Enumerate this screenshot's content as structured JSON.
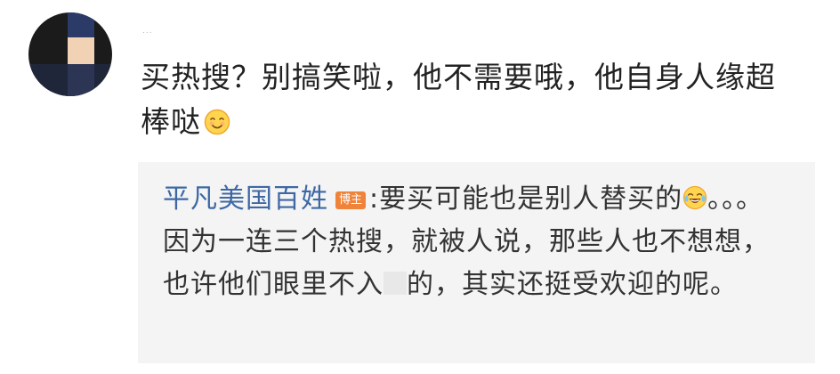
{
  "comment": {
    "username": "...",
    "text": "买热搜？别搞笑啦，他不需要哦，他自身人缘超棒哒",
    "emoji": "smile-emoji"
  },
  "reply": {
    "author": "平凡美国百姓",
    "badge": "博主",
    "separator": ":",
    "text_part1": "要买可能也是别人替买的",
    "emoji": "laugh-cry-emoji",
    "text_part2": "。。。因为一连三个热搜，就被人说，那些人也不想想，也许他们眼里不入",
    "text_part3": "的，其实还挺受欢迎的呢。"
  }
}
